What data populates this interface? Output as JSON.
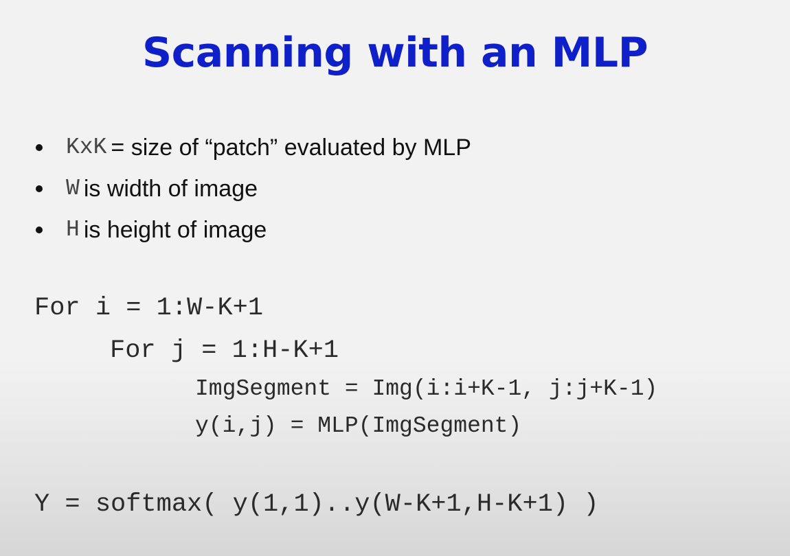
{
  "slide": {
    "title": "Scanning with an MLP",
    "bullets": [
      {
        "code": "KxK",
        "text": "= size of “patch” evaluated by MLP"
      },
      {
        "code": "W",
        "text": "is width of image"
      },
      {
        "code": "H",
        "text": "is height of image"
      }
    ],
    "code_lines": [
      "For i = 1:W-K+1",
      "For j = 1:H-K+1",
      "ImgSegment = Img(i:i+K-1, j:j+K-1)",
      "y(i,j) = MLP(ImgSegment)",
      "Y = softmax( y(1,1)..y(W-K+1,H-K+1) )"
    ],
    "colors": {
      "title": "#1020c8",
      "text": "#111111",
      "code": "#2a2a2a"
    }
  }
}
